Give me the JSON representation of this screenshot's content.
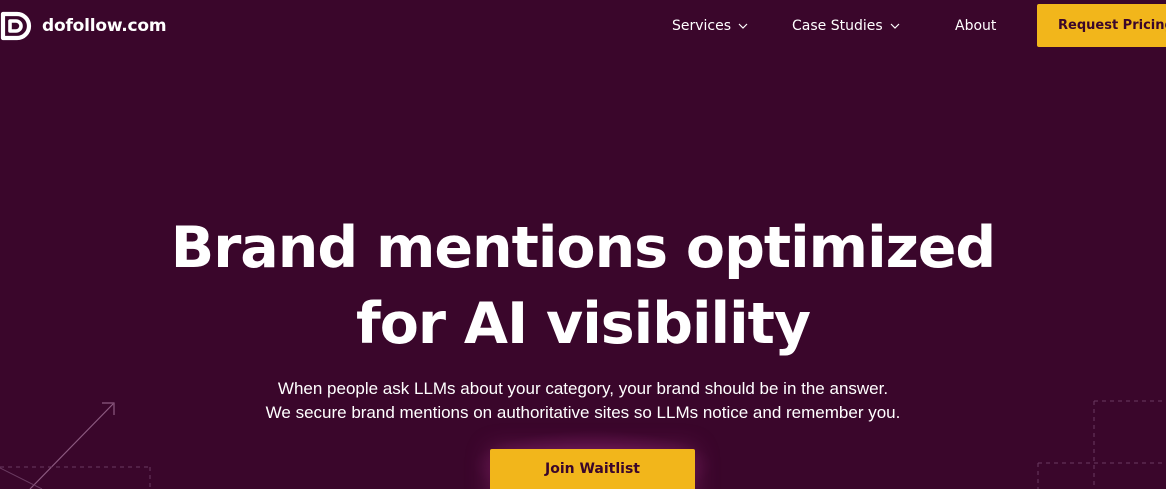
{
  "brand": {
    "name": "dofollow.com",
    "icon": "dofollow-logo-icon"
  },
  "nav": {
    "services": {
      "label": "Services",
      "icon": "chevron-down-icon"
    },
    "case_studies": {
      "label": "Case Studies",
      "icon": "chevron-down-icon"
    },
    "about": {
      "label": "About"
    },
    "request_pricing": {
      "label": "Request Pricing"
    }
  },
  "hero": {
    "title_line1": "Brand mentions optimized",
    "title_line2": "for AI visibility",
    "subtitle_line1": "When people ask LLMs about your category, your brand should be in the answer.",
    "subtitle_line2": "We secure brand mentions on authoritative sites so LLMs notice and remember you.",
    "cta_label": "Join Waitlist"
  },
  "colors": {
    "background": "#3a062b",
    "accent": "#f2b61b",
    "text": "#ffffff"
  }
}
